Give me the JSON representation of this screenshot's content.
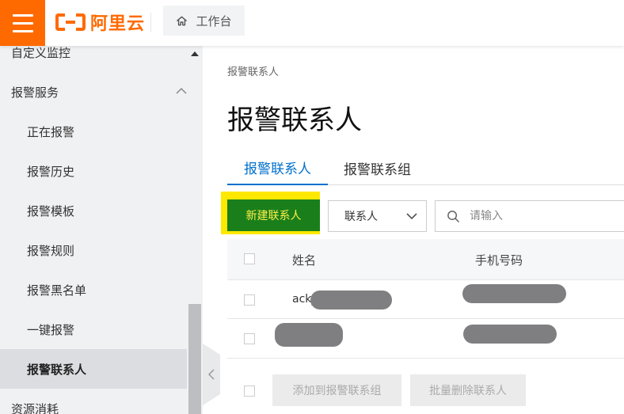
{
  "header": {
    "logo_text": "阿里云",
    "workbench_label": "工作台",
    "brand_color": "#ff6a00"
  },
  "sidebar": {
    "items": [
      {
        "label": "自定义监控",
        "level": "top"
      },
      {
        "label": "报警服务",
        "level": "top",
        "expanded": true
      },
      {
        "label": "正在报警",
        "level": "sub"
      },
      {
        "label": "报警历史",
        "level": "sub"
      },
      {
        "label": "报警模板",
        "level": "sub"
      },
      {
        "label": "报警规则",
        "level": "sub"
      },
      {
        "label": "报警黑名单",
        "level": "sub"
      },
      {
        "label": "一键报警",
        "level": "sub"
      },
      {
        "label": "报警联系人",
        "level": "sub",
        "active": true
      },
      {
        "label": "资源消耗",
        "level": "top"
      }
    ]
  },
  "main": {
    "breadcrumb": "报警联系人",
    "title": "报警联系人",
    "tabs": [
      {
        "label": "报警联系人",
        "active": true
      },
      {
        "label": "报警联系组",
        "active": false
      }
    ],
    "new_contact_button": "新建联系人",
    "filter_select": {
      "selected": "联系人"
    },
    "search": {
      "placeholder": "请输入"
    },
    "table": {
      "columns": [
        "姓名",
        "手机号码"
      ],
      "rows": [
        {
          "name_visible_prefix": "ack_",
          "name_redacted": true,
          "phone_redacted": true
        },
        {
          "name_redacted": true,
          "phone_redacted": true
        }
      ]
    },
    "bulk_actions": {
      "add_to_group": "添加到报警联系组",
      "delete_contacts": "批量删除联系人"
    }
  }
}
